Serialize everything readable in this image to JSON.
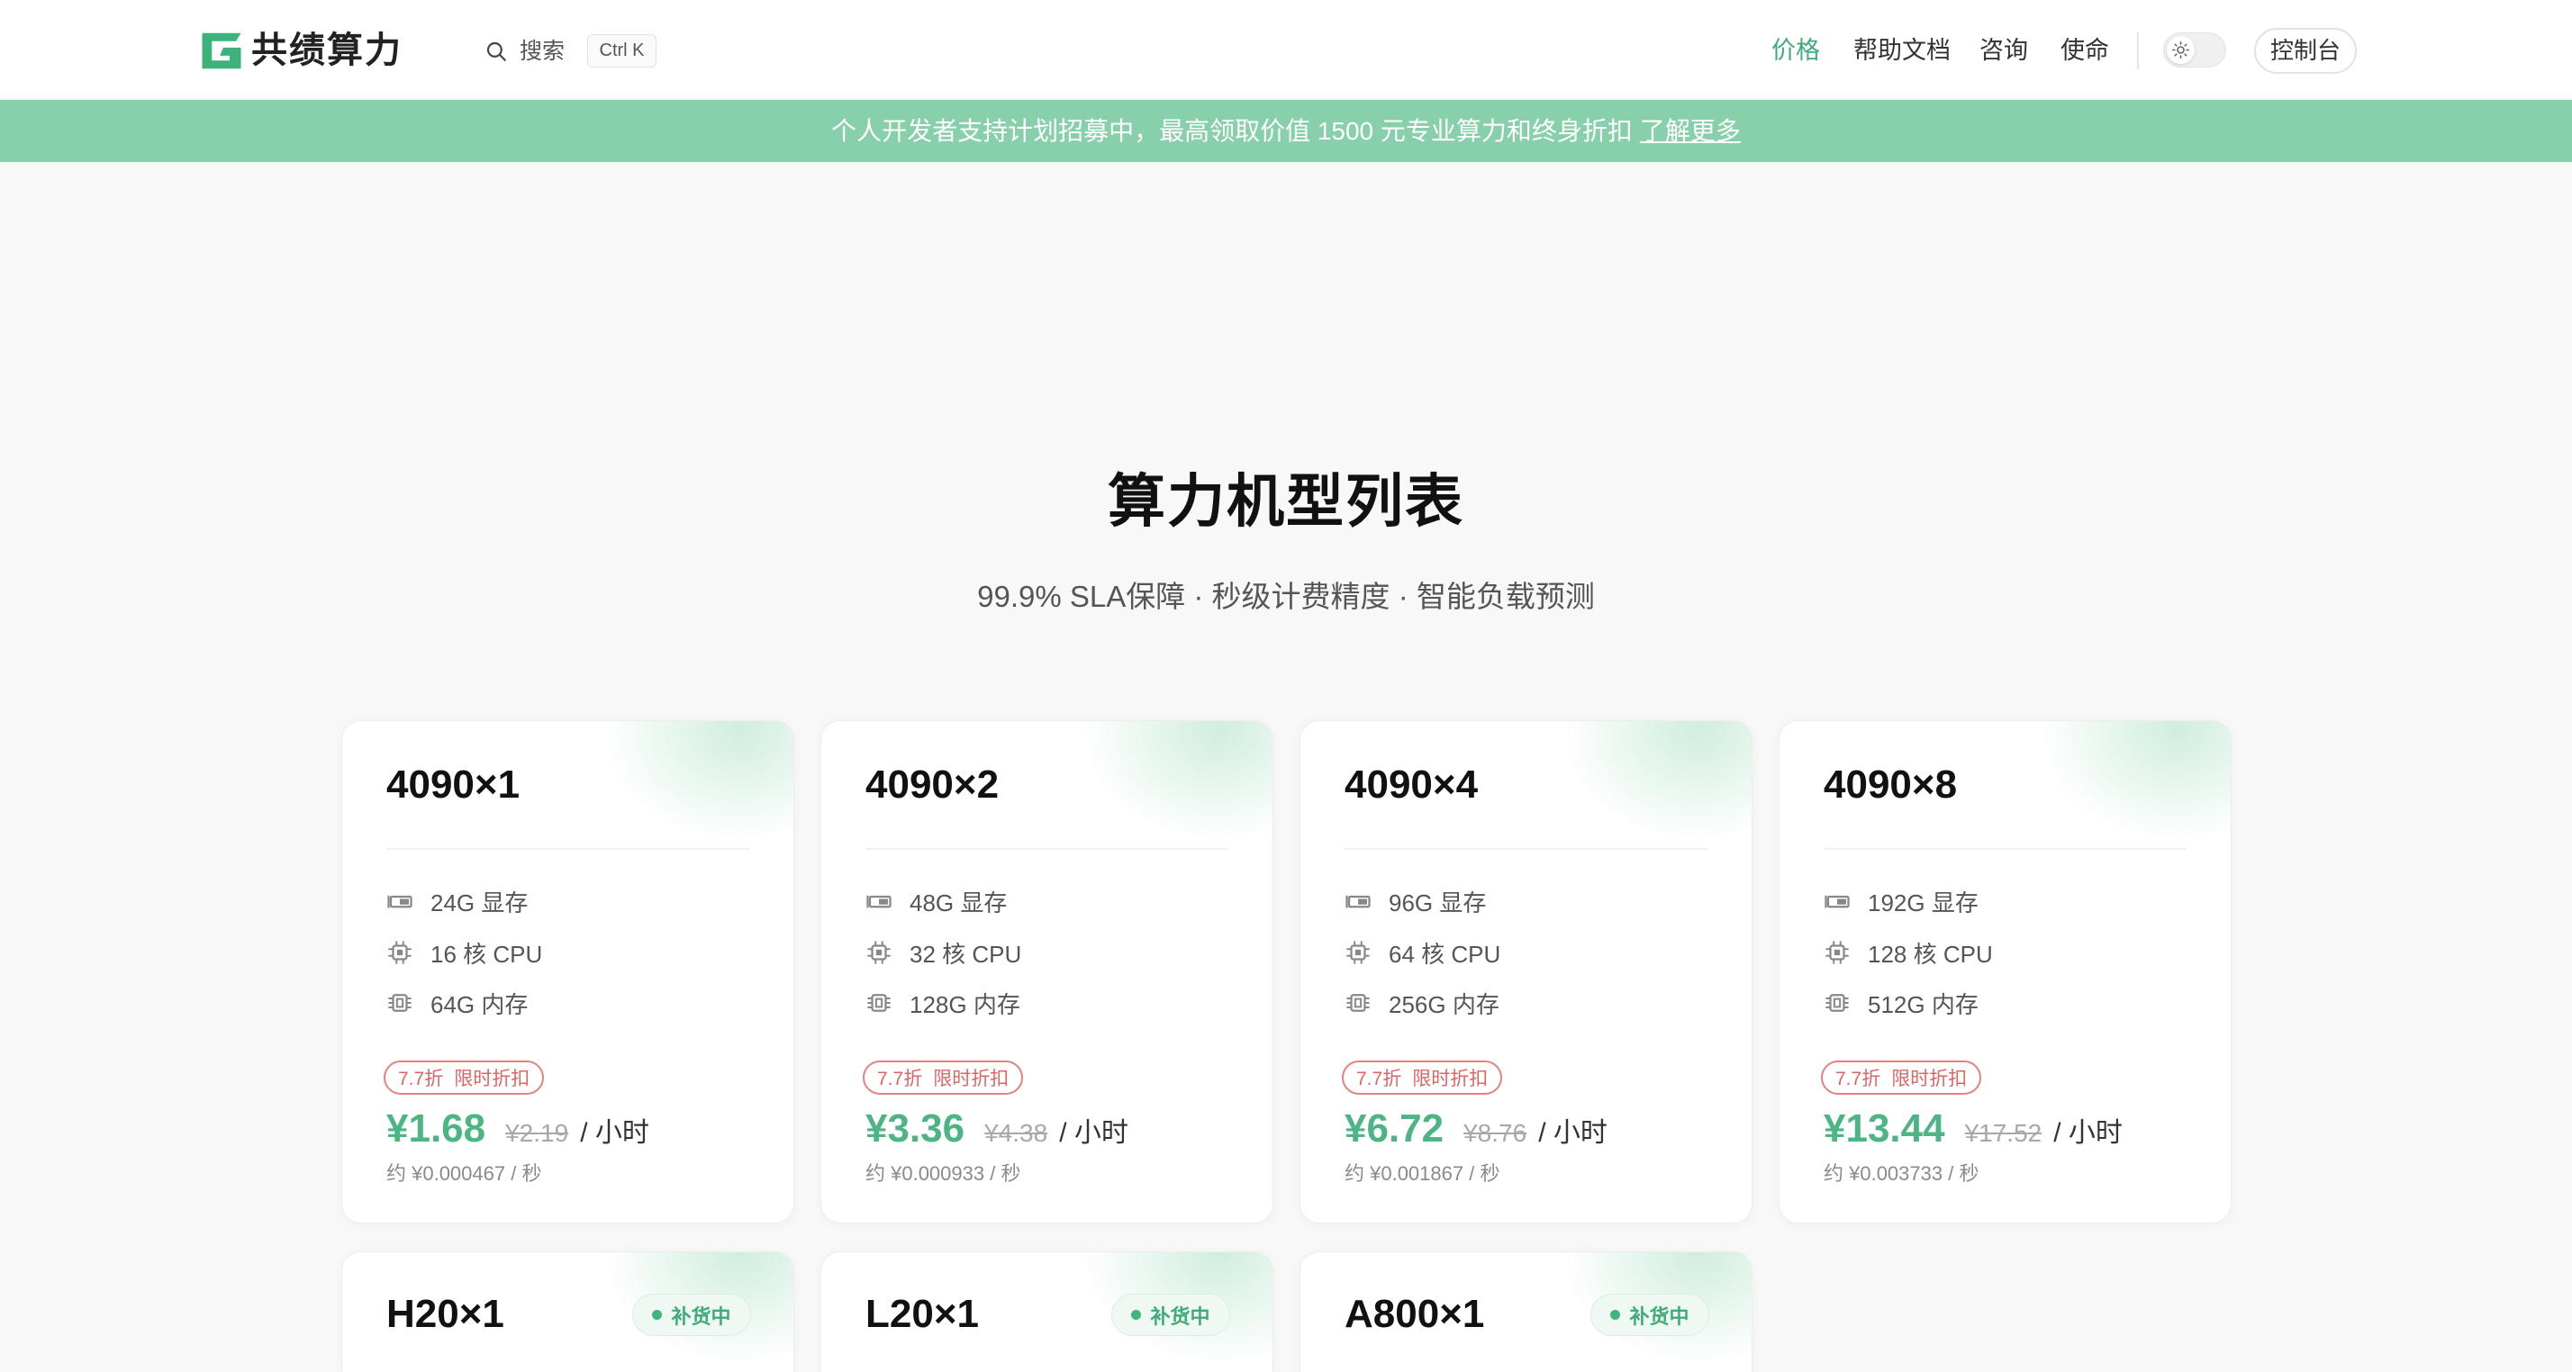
{
  "theme": {
    "accent": "#3fab78",
    "banner_bg": "#88cfab",
    "price_green": "#4db484",
    "discount_red": "#e06464",
    "page_bg": "#f8f8f8"
  },
  "header": {
    "logo_icon": "logo-g-icon",
    "logo_text": "共绩算力",
    "search": {
      "icon": "search-icon",
      "label": "搜索",
      "shortcut": "Ctrl K"
    },
    "nav": [
      {
        "label": "价格",
        "active": true
      },
      {
        "label": "帮助文档",
        "active": false
      },
      {
        "label": "咨询",
        "active": false
      },
      {
        "label": "使命",
        "active": false
      }
    ],
    "theme_toggle": {
      "icon": "sun-icon",
      "mode": "light"
    },
    "console_label": "控制台"
  },
  "banner": {
    "text": "个人开发者支持计划招募中，最高领取价值 1500 元专业算力和终身折扣",
    "link_label": "了解更多"
  },
  "hero": {
    "title": "算力机型列表",
    "subtitle": "99.9% SLA保障 · 秒级计费精度 · 智能负载预测"
  },
  "cards": [
    {
      "name": "4090×1",
      "specs": [
        {
          "icon": "gpu-icon",
          "text": "24G 显存"
        },
        {
          "icon": "cpu-icon",
          "text": "16 核 CPU"
        },
        {
          "icon": "memory-icon",
          "text": "64G 内存"
        }
      ],
      "discount": "7.7折",
      "discount_label": "限时折扣",
      "price": "¥1.68",
      "original_price": "¥2.19",
      "unit": "/ 小时",
      "per_second": "约 ¥0.000467 / 秒"
    },
    {
      "name": "4090×2",
      "specs": [
        {
          "icon": "gpu-icon",
          "text": "48G 显存"
        },
        {
          "icon": "cpu-icon",
          "text": "32 核 CPU"
        },
        {
          "icon": "memory-icon",
          "text": "128G 内存"
        }
      ],
      "discount": "7.7折",
      "discount_label": "限时折扣",
      "price": "¥3.36",
      "original_price": "¥4.38",
      "unit": "/ 小时",
      "per_second": "约 ¥0.000933 / 秒"
    },
    {
      "name": "4090×4",
      "specs": [
        {
          "icon": "gpu-icon",
          "text": "96G 显存"
        },
        {
          "icon": "cpu-icon",
          "text": "64 核 CPU"
        },
        {
          "icon": "memory-icon",
          "text": "256G 内存"
        }
      ],
      "discount": "7.7折",
      "discount_label": "限时折扣",
      "price": "¥6.72",
      "original_price": "¥8.76",
      "unit": "/ 小时",
      "per_second": "约 ¥0.001867 / 秒"
    },
    {
      "name": "4090×8",
      "specs": [
        {
          "icon": "gpu-icon",
          "text": "192G 显存"
        },
        {
          "icon": "cpu-icon",
          "text": "128 核 CPU"
        },
        {
          "icon": "memory-icon",
          "text": "512G 内存"
        }
      ],
      "discount": "7.7折",
      "discount_label": "限时折扣",
      "price": "¥13.44",
      "original_price": "¥17.52",
      "unit": "/ 小时",
      "per_second": "约 ¥0.003733 / 秒"
    }
  ],
  "restocking_cards": [
    {
      "name": "H20×1",
      "status": "补货中"
    },
    {
      "name": "L20×1",
      "status": "补货中"
    },
    {
      "name": "A800×1",
      "status": "补货中"
    }
  ]
}
